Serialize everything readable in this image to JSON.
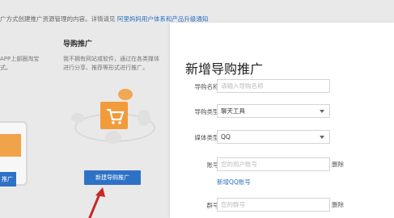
{
  "top_notice": {
    "text": "广方式创建推广资源管理的内容。详情请见",
    "link": "阿里妈妈用户体系和产品升级通知"
  },
  "left_card": {
    "desc": "APP上部圈淘宝\n式。",
    "button_label": "推广"
  },
  "promo_card": {
    "title": "导购推广",
    "desc": "我不拥有网站或软件，通过在各类媒体进行分享、推荐等形式进行推广。",
    "button_label": "新建导购推广"
  },
  "panel": {
    "title": "新增导购推广",
    "fields": {
      "name": {
        "label": "导购名称:",
        "placeholder": "请输入导购名称"
      },
      "type": {
        "label": "导购类型:",
        "value": "聊天工具"
      },
      "media": {
        "label": "媒体类型:",
        "value": "QQ"
      },
      "account": {
        "label": "账号:",
        "placeholder": "您的用户账号",
        "delete": "删除"
      },
      "add_qq": "新增QQ账号",
      "group": {
        "label": "群号:",
        "placeholder": "您的群号",
        "delete": "删除"
      }
    }
  },
  "colors": {
    "accent": "#2e72c6",
    "link": "#2b6fc2",
    "illustration": "#f29b3a"
  }
}
